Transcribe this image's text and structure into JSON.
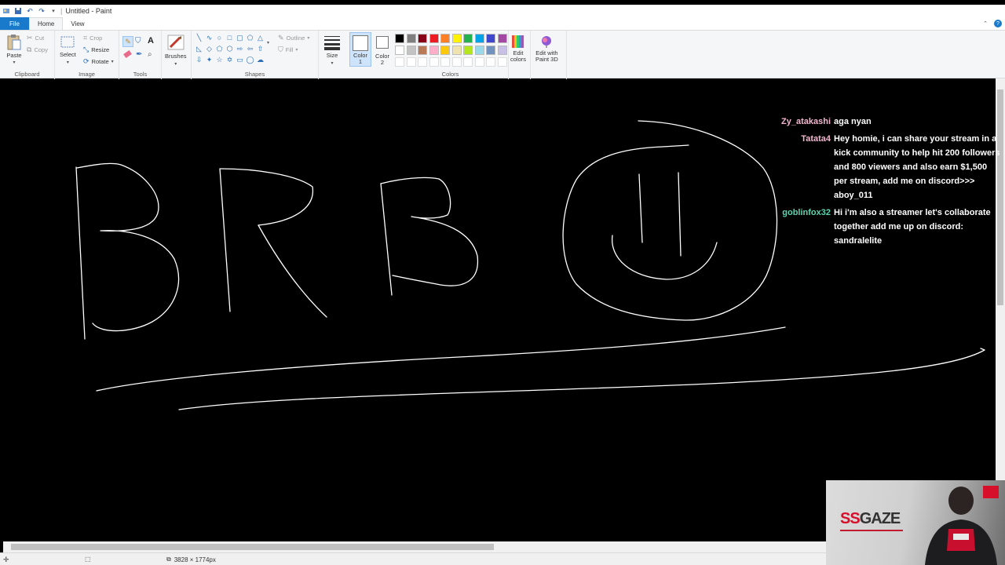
{
  "title_bar": {
    "title": "Untitled - Paint"
  },
  "tabs": [
    {
      "label": "File"
    },
    {
      "label": "Home"
    },
    {
      "label": "View"
    }
  ],
  "ribbon": {
    "clipboard": {
      "paste": "Paste",
      "cut": "Cut",
      "copy": "Copy",
      "group": "Clipboard"
    },
    "image": {
      "select": "Select",
      "crop": "Crop",
      "resize": "Resize",
      "rotate": "Rotate",
      "group": "Image"
    },
    "tools": {
      "group": "Tools"
    },
    "brushes": {
      "label": "Brushes"
    },
    "shapes": {
      "outline": "Outline",
      "fill": "Fill",
      "group": "Shapes"
    },
    "size": {
      "label": "Size"
    },
    "color1": {
      "label": "Color\n1",
      "line1": "Color",
      "line2": "1"
    },
    "color2": {
      "line1": "Color",
      "line2": "2"
    },
    "colors": {
      "group": "Colors"
    },
    "edit_colors": {
      "line1": "Edit",
      "line2": "colors"
    },
    "paint3d": {
      "line1": "Edit with",
      "line2": "Paint 3D"
    }
  },
  "palette": {
    "row1": [
      "#000000",
      "#7f7f7f",
      "#880015",
      "#ed1c24",
      "#ff7f27",
      "#fff200",
      "#22b14c",
      "#00a2e8",
      "#3f48cc",
      "#a349a4"
    ],
    "row2": [
      "#ffffff",
      "#c3c3c3",
      "#b97a57",
      "#ffaec9",
      "#ffc90e",
      "#efe4b0",
      "#b5e61d",
      "#99d9ea",
      "#7092be",
      "#c8bfe7"
    ]
  },
  "status_bar": {
    "canvas_size": "3828 × 1774px"
  },
  "chat": [
    {
      "user": "Zy_atakashi",
      "color": "#f4b6d0",
      "text": "aga nyan"
    },
    {
      "user": "Tatata4",
      "color": "#f4b6d0",
      "text": "Hey homie, i can share your stream in a kick community to help hit 200 followers and 800 viewers and also earn $1,500 per stream, add me on discord>>> aboy_011"
    },
    {
      "user": "goblinfox32",
      "color": "#5bd6b0",
      "text": "Hi i'm also a streamer let's collaborate together add me up on discord: sandralelite"
    }
  ],
  "webcam": {
    "logo_ss": "SS",
    "logo_gaze": "GAZE"
  }
}
